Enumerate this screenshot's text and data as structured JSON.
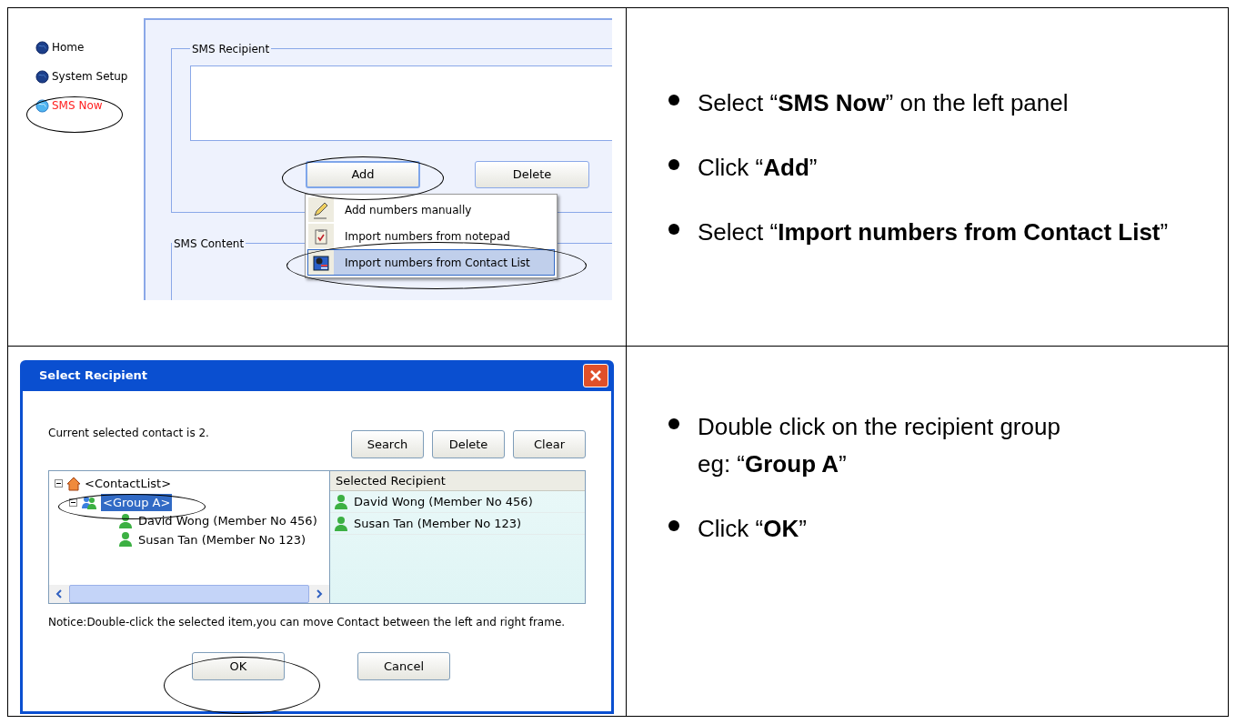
{
  "sms_screen": {
    "nav": [
      {
        "label": "Home",
        "selected": false
      },
      {
        "label": "System Setup",
        "selected": false
      },
      {
        "label": "SMS Now",
        "selected": true
      }
    ],
    "recipient_group": {
      "legend": "SMS Recipient",
      "buttons": [
        "Add",
        "Delete"
      ]
    },
    "add_menu": [
      {
        "label": "Add numbers manually",
        "kind": "pencil",
        "selected": false
      },
      {
        "label": "Import numbers from notepad",
        "kind": "clipboard",
        "selected": false
      },
      {
        "label": "Import numbers from Contact List",
        "kind": "contacts",
        "selected": true
      }
    ],
    "content_group": {
      "legend": "SMS Content"
    }
  },
  "sms_steps": [
    {
      "lines": [
        "Select “**SMS Now**” on the left panel"
      ]
    },
    {
      "lines": [
        "Click “**Add**”"
      ]
    },
    {
      "lines": [
        "Select “**Import numbers from Contact List**”"
      ]
    }
  ],
  "dialog": {
    "title": "Select Recipient",
    "status": "Current selected contact is 2.",
    "buttons": [
      "Search",
      "Delete",
      "Clear"
    ],
    "tree": {
      "label": "<ContactList>",
      "expanded": true,
      "children": [
        {
          "label": "<Group A>",
          "expanded": true,
          "selected": true,
          "children": [
            {
              "label": "David Wong (Member No 456)",
              "selected": false
            },
            {
              "label": "Susan Tan (Member No 123)",
              "selected": false
            }
          ]
        }
      ]
    },
    "selected_header": "Selected Recipient",
    "selected": [
      "David Wong (Member No 456)",
      "Susan Tan (Member No 123)"
    ],
    "notice": "Notice:Double-click the selected item,you can move Contact between the left and right frame.",
    "footer_buttons": [
      "OK",
      "Cancel"
    ]
  },
  "dialog_steps": [
    {
      "lines": [
        "Double click on the recipient group",
        "eg: “**Group A**”"
      ]
    },
    {
      "lines": [
        "Click “**OK**”"
      ]
    }
  ]
}
